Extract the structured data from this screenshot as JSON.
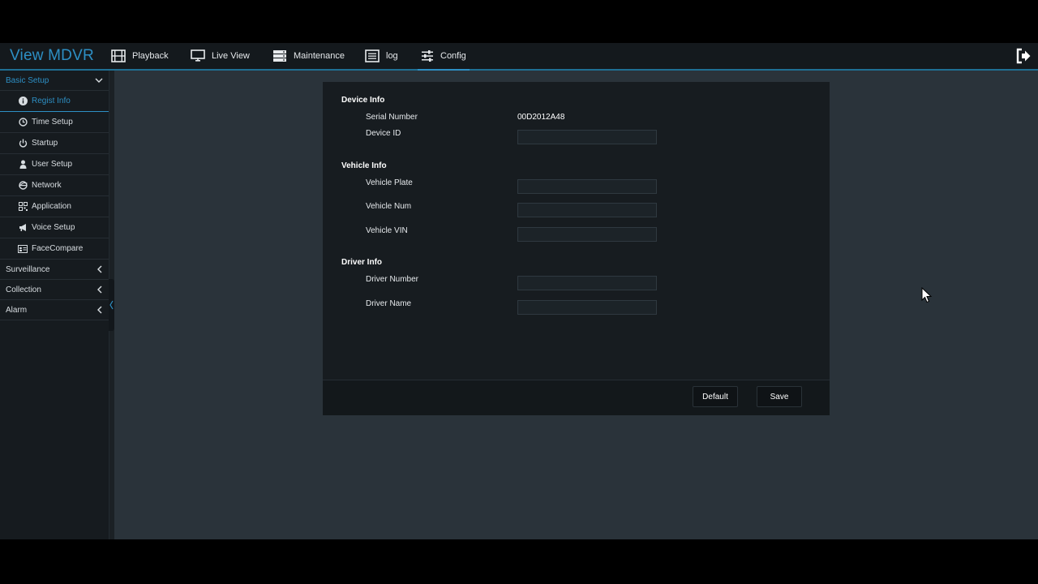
{
  "app": {
    "title": "View MDVR"
  },
  "nav": {
    "playback": "Playback",
    "live_view": "Live View",
    "maintenance": "Maintenance",
    "log": "log",
    "config": "Config"
  },
  "sidebar": {
    "basic_setup": "Basic Setup",
    "items": [
      {
        "label": "Regist Info",
        "icon": "info-icon"
      },
      {
        "label": "Time Setup",
        "icon": "clock-icon"
      },
      {
        "label": "Startup",
        "icon": "power-icon"
      },
      {
        "label": "User Setup",
        "icon": "user-icon"
      },
      {
        "label": "Network",
        "icon": "globe-icon"
      },
      {
        "label": "Application",
        "icon": "qr-icon"
      },
      {
        "label": "Voice Setup",
        "icon": "megaphone-icon"
      },
      {
        "label": "FaceCompare",
        "icon": "id-card-icon"
      }
    ],
    "surveillance": "Surveillance",
    "collection": "Collection",
    "alarm": "Alarm"
  },
  "form": {
    "device_info": {
      "title": "Device Info",
      "serial_label": "Serial Number",
      "serial_value": "00D2012A48",
      "device_id_label": "Device ID",
      "device_id_value": ""
    },
    "vehicle_info": {
      "title": "Vehicle Info",
      "plate_label": "Vehicle Plate",
      "plate_value": "",
      "num_label": "Vehicle Num",
      "num_value": "",
      "vin_label": "Vehicle VIN",
      "vin_value": ""
    },
    "driver_info": {
      "title": "Driver Info",
      "number_label": "Driver Number",
      "number_value": "",
      "name_label": "Driver Name",
      "name_value": ""
    }
  },
  "buttons": {
    "default": "Default",
    "save": "Save"
  },
  "colors": {
    "accent": "#2d8fc4",
    "panel": "#171c20",
    "background": "#2a333a"
  }
}
